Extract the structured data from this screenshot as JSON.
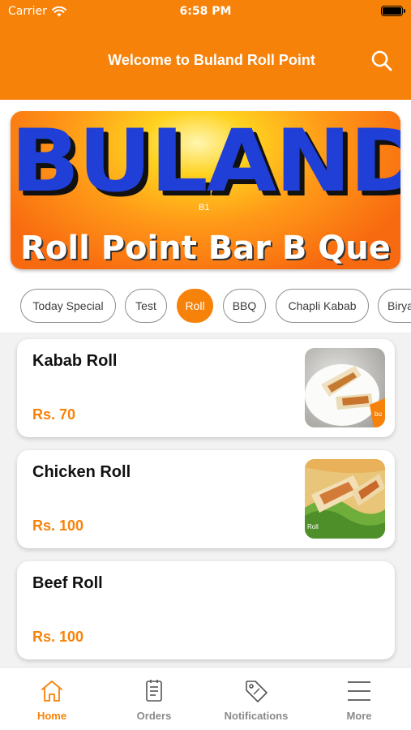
{
  "status_bar": {
    "carrier": "Carrier",
    "time": "6:58 PM"
  },
  "header": {
    "title": "Welcome to Buland Roll Point"
  },
  "banner": {
    "line1": "BULAND",
    "line2": "Roll Point Bar B Que",
    "mark": "B1"
  },
  "categories": [
    {
      "label": "Today Special",
      "active": false
    },
    {
      "label": "Test",
      "active": false
    },
    {
      "label": "Roll",
      "active": true
    },
    {
      "label": "BBQ",
      "active": false
    },
    {
      "label": "Chapli Kabab",
      "active": false
    },
    {
      "label": "Biryani",
      "active": false
    }
  ],
  "items": [
    {
      "name": "Kabab Roll",
      "price": "Rs. 70"
    },
    {
      "name": "Chicken Roll",
      "price": "Rs. 100"
    },
    {
      "name": "Beef Roll",
      "price": "Rs. 100"
    }
  ],
  "tabs": [
    {
      "label": "Home",
      "icon": "home-icon",
      "active": true
    },
    {
      "label": "Orders",
      "icon": "orders-icon",
      "active": false
    },
    {
      "label": "Notifications",
      "icon": "tag-icon",
      "active": false
    },
    {
      "label": "More",
      "icon": "menu-icon",
      "active": false
    }
  ],
  "colors": {
    "accent": "#f7820a",
    "banner_text": "#1f3fd6"
  }
}
